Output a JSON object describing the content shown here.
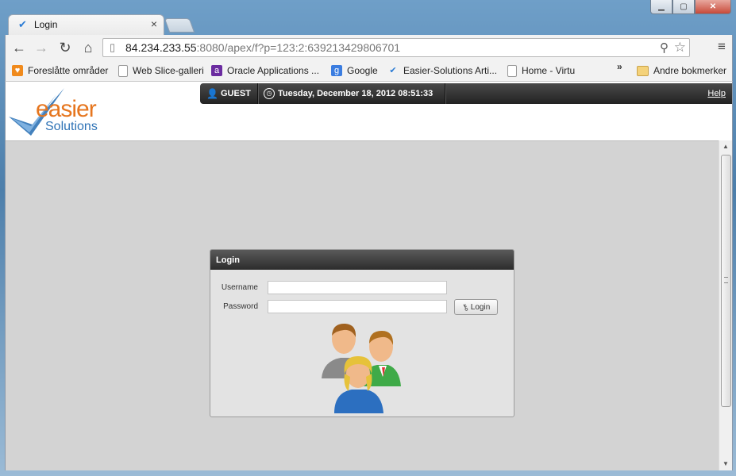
{
  "browser": {
    "tab": {
      "title": "Login"
    },
    "address": {
      "host": "84.234.233.55",
      "rest": ":8080/apex/f?p=123:2:639213429806701"
    },
    "bookmarks": [
      {
        "label": "Foreslåtte områder",
        "icon": "suggested-sites-icon",
        "color": "#f08a1c"
      },
      {
        "label": "Web Slice-galleri",
        "icon": "page-icon",
        "color": "#ffffff"
      },
      {
        "label": "Oracle Applications ...",
        "icon": "oracle-apps-icon",
        "color": "#6b2ca0"
      },
      {
        "label": "Google",
        "icon": "google-icon",
        "color": "#3b7de0"
      },
      {
        "label": "Easier-Solutions Arti...",
        "icon": "easier-check-icon",
        "color": "#2a7bd4"
      },
      {
        "label": "Home - Virtu",
        "icon": "page-icon",
        "color": "#ffffff"
      }
    ],
    "bookmarks_more": "»",
    "other_bookmarks": "Andre bokmerker"
  },
  "header": {
    "logo": {
      "word1": "easier",
      "word2": "Solutions"
    },
    "user": "GUEST",
    "datetime": "Tuesday, December 18, 2012 08:51:33",
    "help": "Help"
  },
  "login": {
    "title": "Login",
    "username_label": "Username",
    "username_value": "",
    "password_label": "Password",
    "password_value": "",
    "button_label": "Login"
  },
  "colors": {
    "brand_orange": "#e6761f",
    "brand_blue": "#2f73b6",
    "page_bg": "#d3d3d3",
    "bar_dark": "#2c2c2c"
  }
}
